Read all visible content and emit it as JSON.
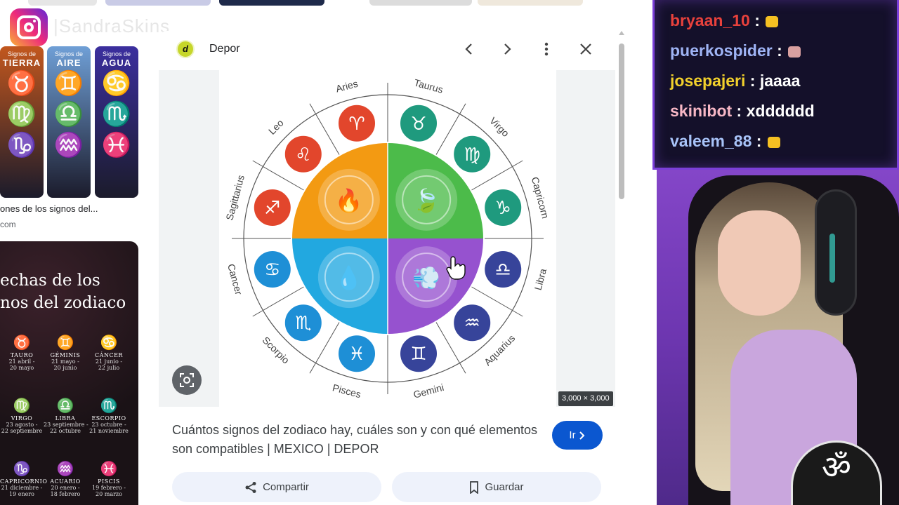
{
  "watermark": {
    "handle": "|SandraSkins"
  },
  "left_results": {
    "card1": {
      "columns": [
        {
          "header_small": "Signos de",
          "header": "TIERRA",
          "symbols": [
            "♉",
            "♍",
            "♑"
          ],
          "color": "#c2571e"
        },
        {
          "header_small": "Signos de",
          "header": "AIRE",
          "symbols": [
            "♊",
            "♎",
            "♒"
          ],
          "color": "#6f9fd6"
        },
        {
          "header_small": "Signos de",
          "header": "AGUA",
          "symbols": [
            "♋",
            "♏",
            "♓"
          ],
          "color": "#3b2f9e"
        }
      ],
      "title": "ones de los signos del...",
      "site": "com"
    },
    "card2": {
      "title": "echas de los\nnos del zodiaco",
      "signs": [
        {
          "symbol": "♉",
          "name": "TAURO",
          "dates": "21 abril -\n20 mayo"
        },
        {
          "symbol": "♊",
          "name": "GÉMINIS",
          "dates": "21 mayo -\n20 junio"
        },
        {
          "symbol": "♋",
          "name": "CÁNCER",
          "dates": "21 junio -\n22 julio"
        },
        {
          "symbol": "♍",
          "name": "VIRGO",
          "dates": "23 agosto -\n22 septiembre"
        },
        {
          "symbol": "♎",
          "name": "LIBRA",
          "dates": "23 septiembre -\n22 octubre"
        },
        {
          "symbol": "♏",
          "name": "ESCORPIO",
          "dates": "23 octubre -\n21 noviembre"
        },
        {
          "symbol": "♑",
          "name": "CAPRICORNIO",
          "dates": "21 diciembre -\n19 enero"
        },
        {
          "symbol": "♒",
          "name": "ACUARIO",
          "dates": "20 enero -\n18 febrero"
        },
        {
          "symbol": "♓",
          "name": "PISCIS",
          "dates": "19 febrero -\n20 marzo"
        }
      ]
    }
  },
  "preview": {
    "source_initial": "d",
    "source_name": "Depor",
    "icons": {
      "prev": "chevron-left-icon",
      "next": "chevron-right-icon",
      "more": "more-vert-icon",
      "close": "close-icon",
      "lens": "lens-icon"
    },
    "dimensions": "3,000 × 3,000",
    "title": "Cuántos signos del zodiaco hay, cuáles son y con qué elementos son compatibles | MEXICO | DEPOR",
    "go_label": "Ir",
    "share_label": "Compartir",
    "save_label": "Guardar",
    "wheel": {
      "signs": [
        {
          "name": "Aries",
          "symbol": "♈",
          "color": "#e2462c"
        },
        {
          "name": "Taurus",
          "symbol": "♉",
          "color": "#1f9a7e"
        },
        {
          "name": "Virgo",
          "symbol": "♍",
          "color": "#1f9a7e"
        },
        {
          "name": "Capricorn",
          "symbol": "♑",
          "color": "#1f9a7e"
        },
        {
          "name": "Libra",
          "symbol": "♎",
          "color": "#37449a"
        },
        {
          "name": "Aquarius",
          "symbol": "♒",
          "color": "#37449a"
        },
        {
          "name": "Gemini",
          "symbol": "♊",
          "color": "#37449a"
        },
        {
          "name": "Pisces",
          "symbol": "♓",
          "color": "#1e8fd6"
        },
        {
          "name": "Scorpio",
          "symbol": "♏",
          "color": "#1e8fd6"
        },
        {
          "name": "Cancer",
          "symbol": "♋",
          "color": "#1e8fd6"
        },
        {
          "name": "Sagittarius",
          "symbol": "♐",
          "color": "#e2462c"
        },
        {
          "name": "Leo",
          "symbol": "♌",
          "color": "#e2462c"
        }
      ],
      "elements": [
        {
          "name": "fire",
          "color": "#f39a12",
          "glyph": "🔥"
        },
        {
          "name": "earth",
          "color": "#4cbb4a",
          "glyph": "🍃"
        },
        {
          "name": "air",
          "color": "#9652cf",
          "glyph": "💨"
        },
        {
          "name": "water",
          "color": "#22a8e0",
          "glyph": "💧"
        }
      ]
    }
  },
  "chat": [
    {
      "user": "bryaan_10",
      "message": "",
      "user_color": "#e8413c",
      "emote": "#f5c022"
    },
    {
      "user": "puerkospider",
      "message": "",
      "user_color": "#9fb4f5",
      "emote": "#d9a0a0"
    },
    {
      "user": "josepajeri",
      "message": "jaaaa",
      "user_color": "#f2d02c",
      "emote": ""
    },
    {
      "user": "skinibot",
      "message": "xdddddd",
      "user_color": "#f7b7c5",
      "emote": ""
    },
    {
      "user": "valeem_88",
      "message": "",
      "user_color": "#a8c3f8",
      "emote": "#f5c022"
    }
  ],
  "overlay": {
    "om_glyph": "ॐ"
  }
}
